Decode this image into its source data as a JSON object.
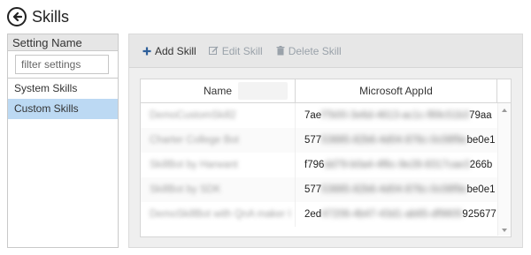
{
  "header": {
    "title": "Skills"
  },
  "left": {
    "heading": "Setting Name",
    "filter_placeholder": "filter settings",
    "items": [
      {
        "label": "System Skills",
        "active": false
      },
      {
        "label": "Custom Skills",
        "active": true
      }
    ]
  },
  "toolbar": {
    "add_label": "Add Skill",
    "edit_label": "Edit Skill",
    "delete_label": "Delete Skill"
  },
  "grid": {
    "columns": [
      "Name",
      "Microsoft AppId"
    ],
    "rows": [
      {
        "name": "DemoCustomSkill2",
        "appid_start": "7ae",
        "appid_mid": "f7b00-3e6d-4613-ac1c-f89c51b3",
        "appid_end": "79aa"
      },
      {
        "name": "Charter College Bot",
        "appid_start": "577",
        "appid_mid": "53885-82b6-4d04-876c-0c08f9e",
        "appid_end": "be0e1"
      },
      {
        "name": "SkillBot by Harwant",
        "appid_start": "f796",
        "appid_mid": "dd79-b0a4-4f6c-9e28-8317cae3",
        "appid_end": "266b"
      },
      {
        "name": "SkillBot by SDK",
        "appid_start": "577",
        "appid_mid": "53885-82b6-4d04-876c-0c08f9e",
        "appid_end": "be0e1"
      },
      {
        "name": "DemoSkillBot with QnA maker I",
        "appid_start": "2ed",
        "appid_mid": "47206-4b47-43d1-ab65-df9805",
        "appid_end": "925677"
      }
    ]
  }
}
